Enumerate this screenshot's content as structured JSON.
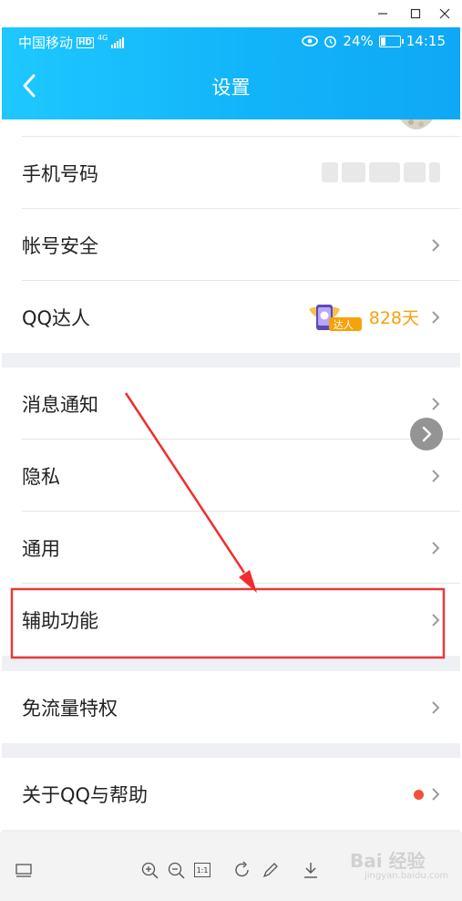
{
  "status": {
    "carrier": "中国移动",
    "hd": "HD",
    "network": "4G",
    "battery": "24%",
    "battery_level": 0.24,
    "time": "14:15"
  },
  "header": {
    "title": "设置"
  },
  "settings": {
    "phone": "手机号码",
    "security": "帐号安全",
    "qq_master": "QQ达人",
    "qq_master_badge": "达人",
    "qq_master_days": "828天",
    "notifications": "消息通知",
    "privacy": "隐私",
    "general": "通用",
    "accessibility": "辅助功能",
    "free_data": "免流量特权",
    "about": "关于QQ与帮助"
  },
  "colors": {
    "header": "#12b4f9",
    "highlight_box": "#e83a3a",
    "arrow": "#f12d2d",
    "badge_days": "#f5a30b",
    "notify_dot": "#f3503a"
  },
  "toolbar": {
    "icons": [
      "layout-icon",
      "zoom-in-icon",
      "zoom-out-icon",
      "actual-size-icon",
      "rotate-icon",
      "edit-icon",
      "download-icon"
    ],
    "actual_size": "1:1"
  },
  "watermark": {
    "text": "Bai 经验",
    "sub": "jingyan.baidu.com"
  }
}
